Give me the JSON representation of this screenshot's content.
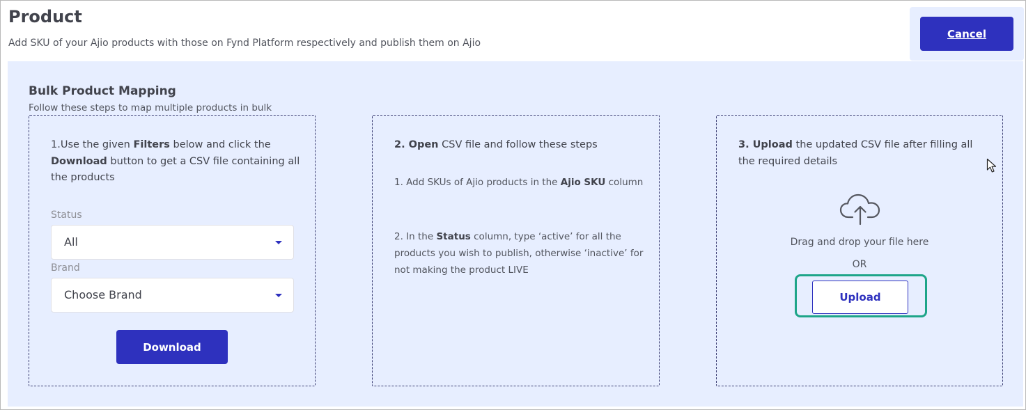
{
  "header": {
    "title": "Product",
    "subtitle": "Add SKU of your Ajio products with those on Fynd Platform respectively and publish them on Ajio",
    "cancel_label": "Cancel"
  },
  "section": {
    "title": "Bulk Product Mapping",
    "subtitle": "Follow these steps to map multiple products in bulk"
  },
  "step1": {
    "text_a": "1.Use the given ",
    "bold_a": "Filters",
    "text_b": " below and click the ",
    "bold_b": "Download",
    "text_c": " button to get a CSV file containing all the products",
    "status_label": "Status",
    "status_value": "All",
    "brand_label": "Brand",
    "brand_value": "Choose Brand",
    "download_label": "Download"
  },
  "step2": {
    "bold_a": "2. Open",
    "text_a": " CSV file and follow these steps",
    "note1_a": "1. Add SKUs of Ajio products in the ",
    "note1_bold": "Ajio SKU",
    "note1_b": " column",
    "note2_a": "2. In the ",
    "note2_bold": "Status",
    "note2_b": " column, type ‘active’ for all the products you wish to publish, otherwise ‘inactive’ for not making the product LIVE"
  },
  "step3": {
    "bold_a": "3. Upload",
    "text_a": " the updated CSV file after filling all the required details",
    "cloud_icon": "cloud-upload-icon",
    "drag_text": "Drag and drop your file here",
    "or_text": "OR",
    "upload_label": "Upload"
  },
  "colors": {
    "accent": "#2e31be",
    "panel_bg": "#e7eeff",
    "focus_ring": "#1ea589"
  }
}
